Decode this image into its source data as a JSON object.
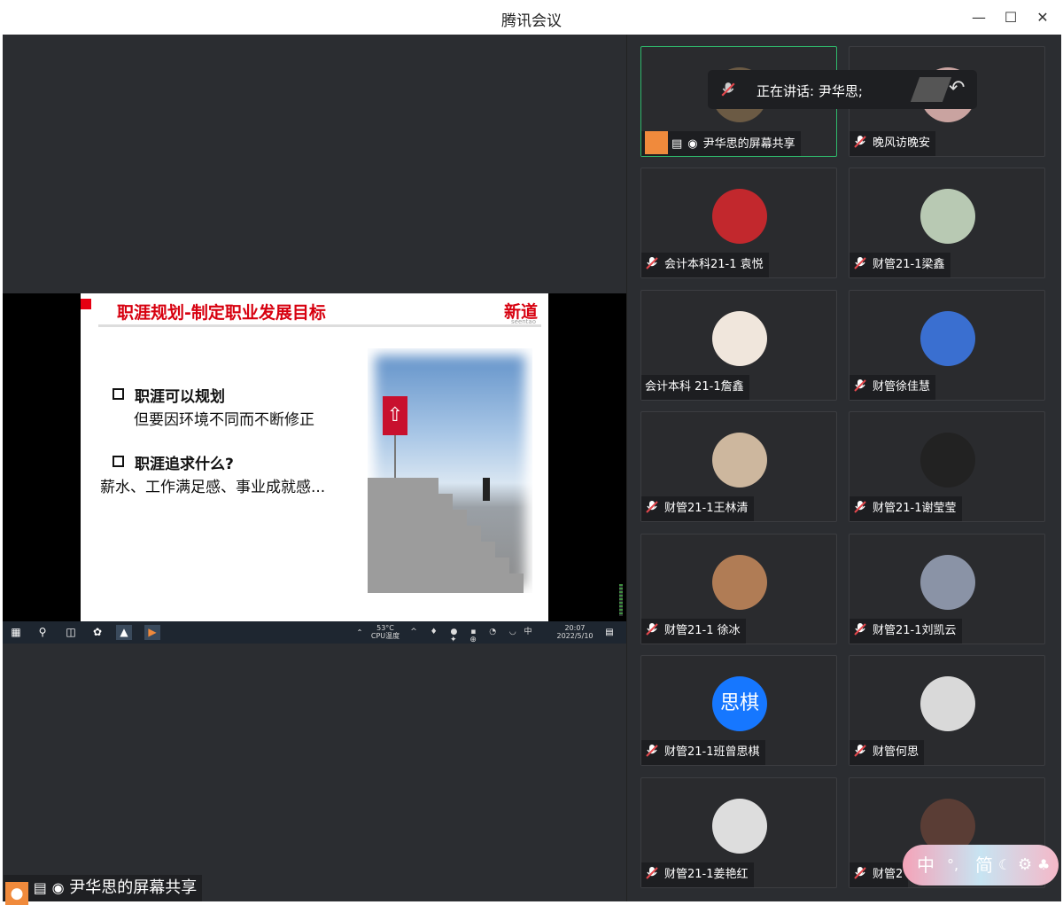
{
  "window": {
    "title": "腾讯会议"
  },
  "speaking": {
    "label": "正在讲话: 尹华思;"
  },
  "share": {
    "label": "尹华思的屏幕共享"
  },
  "slide": {
    "title": "职涯规划-制定职业发展目标",
    "logo": "新道",
    "logo_sub": "seentao",
    "bullet1": "职涯可以规划",
    "bullet1_sub": "但要因环境不同而不断修正",
    "bullet2": "职涯追求什么?",
    "bullet2_sub": "薪水、工作满足感、事业成就感..."
  },
  "taskbar": {
    "weather": "53°C",
    "cpu": "CPU温度",
    "time": "20:07",
    "date": "2022/5/10",
    "ime": "中"
  },
  "participants": [
    {
      "name": "尹华思的屏幕共享",
      "avatar_color": "#6b5a44"
    },
    {
      "name": "晚风访晚安",
      "avatar_color": "#c9a3a0"
    },
    {
      "name": "会计本科21-1 袁悦",
      "avatar_color": "#c2282d"
    },
    {
      "name": "财管21-1梁鑫",
      "avatar_color": "#b8c9b3"
    },
    {
      "name": "会计本科 21-1詹鑫",
      "avatar_color": "#f0e6dc"
    },
    {
      "name": "财管徐佳慧",
      "avatar_color": "#3a6fd0"
    },
    {
      "name": "财管21-1王林清",
      "avatar_color": "#cdb79e"
    },
    {
      "name": "财管21-1谢莹莹",
      "avatar_color": "#222222"
    },
    {
      "name": "财管21-1 徐冰",
      "avatar_color": "#b07c55"
    },
    {
      "name": "财管21-1刘凯云",
      "avatar_color": "#8a93a6"
    },
    {
      "name": "财管21-1班曾思棋",
      "avatar_text": "思棋",
      "avatar_color": "#1677ff"
    },
    {
      "name": "财管何思",
      "avatar_color": "#d9d9d9"
    },
    {
      "name": "财管21-1姜艳红",
      "avatar_color": "#dddddd"
    },
    {
      "name": "财管2",
      "avatar_color": "#5a3d35"
    }
  ],
  "ime_bar": {
    "lang": "中",
    "mode": "简"
  }
}
